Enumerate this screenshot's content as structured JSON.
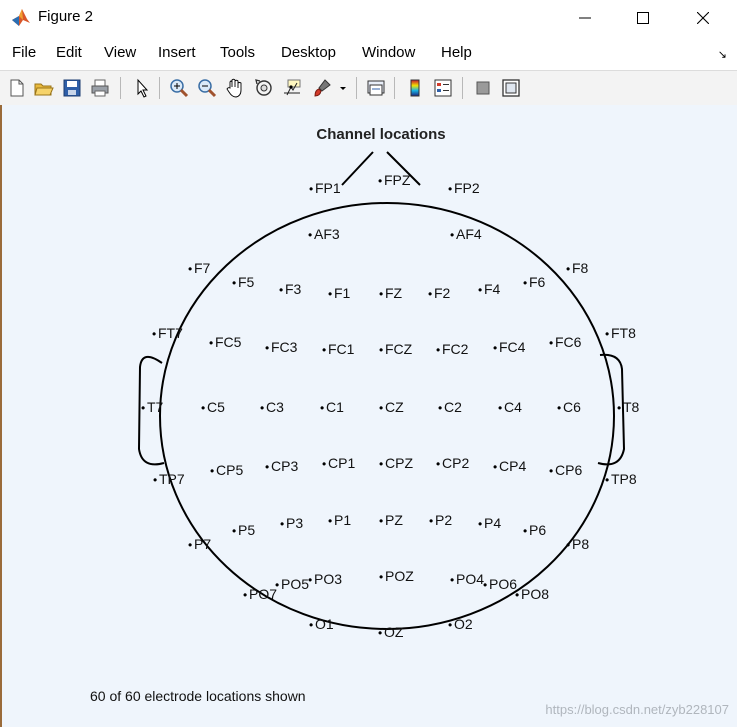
{
  "window": {
    "title": "Figure 2",
    "icon": "matlab-icon",
    "controls": [
      "minimize-icon",
      "maximize-icon",
      "close-icon"
    ]
  },
  "menu": {
    "items": [
      {
        "label": "File"
      },
      {
        "label": "Edit"
      },
      {
        "label": "View"
      },
      {
        "label": "Insert"
      },
      {
        "label": "Tools"
      },
      {
        "label": "Desktop"
      },
      {
        "label": "Window"
      },
      {
        "label": "Help"
      }
    ],
    "corner_glyph": "↘"
  },
  "toolbar": {
    "buttons": [
      "new-figure-icon",
      "open-file-icon",
      "save-icon",
      "print-icon",
      "edit-plot-pointer-icon",
      "zoom-in-icon",
      "zoom-out-icon",
      "pan-hand-icon",
      "rotate-3d-icon",
      "data-cursor-icon",
      "brush-icon",
      "brush-dropdown-icon",
      "link-plot-icon",
      "insert-colorbar-icon",
      "insert-legend-icon",
      "hide-plot-tools-icon",
      "show-plot-tools-icon"
    ]
  },
  "figure": {
    "title": "Channel locations",
    "caption": "60 of 60 electrode locations shown",
    "watermark": "https://blog.csdn.net/zyb228107",
    "electrodes": [
      {
        "label": "FP1"
      },
      {
        "label": "FPZ"
      },
      {
        "label": "FP2"
      },
      {
        "label": "AF3"
      },
      {
        "label": "AF4"
      },
      {
        "label": "F7"
      },
      {
        "label": "F5"
      },
      {
        "label": "F3"
      },
      {
        "label": "F1"
      },
      {
        "label": "FZ"
      },
      {
        "label": "F2"
      },
      {
        "label": "F4"
      },
      {
        "label": "F6"
      },
      {
        "label": "F8"
      },
      {
        "label": "FT7"
      },
      {
        "label": "FC5"
      },
      {
        "label": "FC3"
      },
      {
        "label": "FC1"
      },
      {
        "label": "FCZ"
      },
      {
        "label": "FC2"
      },
      {
        "label": "FC4"
      },
      {
        "label": "FC6"
      },
      {
        "label": "FT8"
      },
      {
        "label": "T7"
      },
      {
        "label": "C5"
      },
      {
        "label": "C3"
      },
      {
        "label": "C1"
      },
      {
        "label": "CZ"
      },
      {
        "label": "C2"
      },
      {
        "label": "C4"
      },
      {
        "label": "C6"
      },
      {
        "label": "T8"
      },
      {
        "label": "TP7"
      },
      {
        "label": "CP5"
      },
      {
        "label": "CP3"
      },
      {
        "label": "CP1"
      },
      {
        "label": "CPZ"
      },
      {
        "label": "CP2"
      },
      {
        "label": "CP4"
      },
      {
        "label": "CP6"
      },
      {
        "label": "TP8"
      },
      {
        "label": "P7"
      },
      {
        "label": "P5"
      },
      {
        "label": "P3"
      },
      {
        "label": "P1"
      },
      {
        "label": "PZ"
      },
      {
        "label": "P2"
      },
      {
        "label": "P4"
      },
      {
        "label": "P6"
      },
      {
        "label": "P8"
      },
      {
        "label": "PO7"
      },
      {
        "label": "PO5"
      },
      {
        "label": "PO3"
      },
      {
        "label": "POZ"
      },
      {
        "label": "PO4"
      },
      {
        "label": "PO6"
      },
      {
        "label": "PO8"
      },
      {
        "label": "O1"
      },
      {
        "label": "OZ"
      },
      {
        "label": "O2"
      }
    ]
  }
}
